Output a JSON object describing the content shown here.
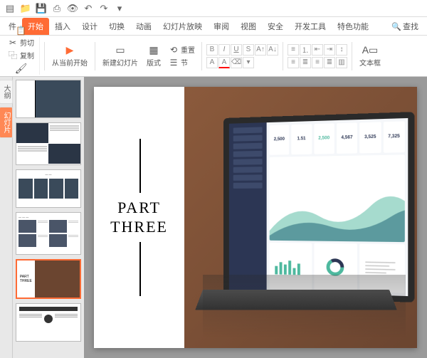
{
  "quickAccess": {
    "icons": [
      "file-icon",
      "folder-icon",
      "save-icon",
      "undo-icon",
      "redo-icon",
      "print-icon",
      "refresh-icon"
    ]
  },
  "tabs": {
    "items": [
      "件",
      "开始",
      "插入",
      "设计",
      "切换",
      "动画",
      "幻灯片放映",
      "审阅",
      "视图",
      "安全",
      "开发工具",
      "特色功能"
    ],
    "activeIndex": 1,
    "search": "查找"
  },
  "ribbon": {
    "cut": "剪切",
    "copy": "复制",
    "formatPainter": "格式刷",
    "fromCurrent": "从当前开始",
    "newSlide": "新建幻灯片",
    "layout": "版式",
    "section": "节",
    "reset": "重置",
    "textbox": "文本框"
  },
  "viewTabs": {
    "outline": "大纲",
    "slides": "幻灯片"
  },
  "slide": {
    "titleLine1": "PART",
    "titleLine2": "THREE"
  },
  "dashboard": {
    "stats": [
      {
        "value": "2,500"
      },
      {
        "value": "1.51"
      },
      {
        "value": "2,500"
      },
      {
        "value": "4,567"
      },
      {
        "value": "3,525"
      },
      {
        "value": "7,325"
      }
    ]
  },
  "thumbnails": {
    "selectedIndex": 4,
    "count": 6,
    "slide5": {
      "line1": "PART",
      "line2": "THREE"
    }
  }
}
